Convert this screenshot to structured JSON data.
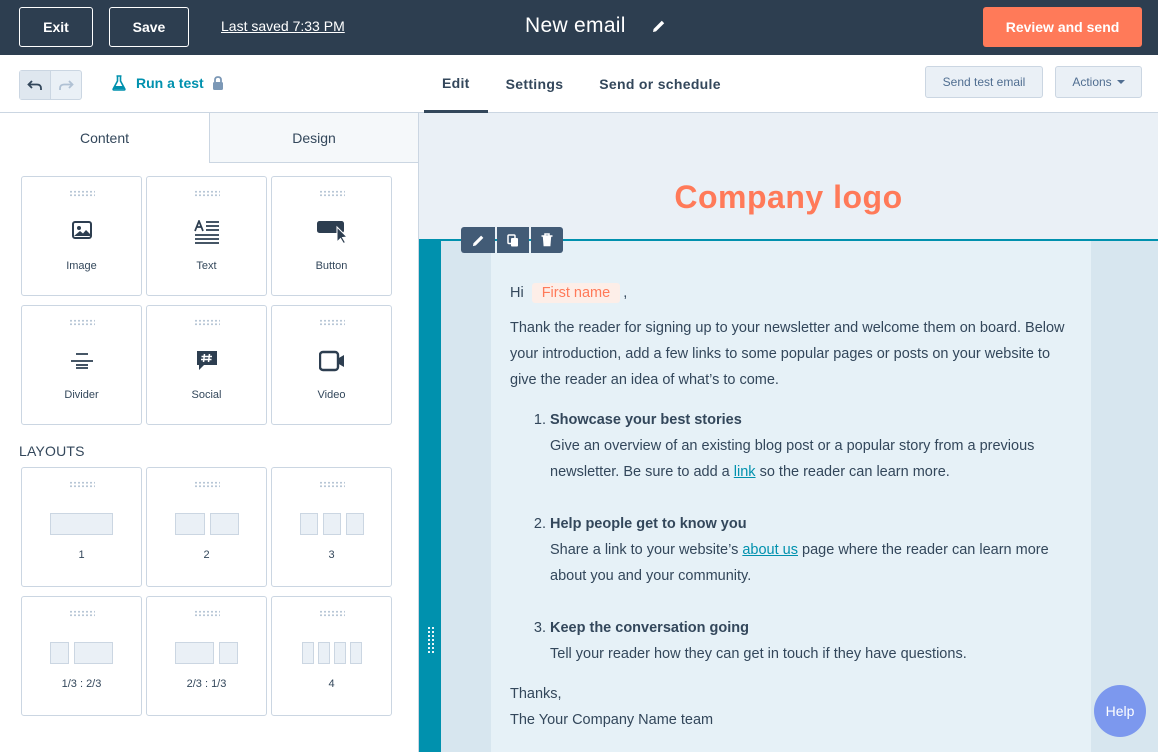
{
  "topbar": {
    "exit_label": "Exit",
    "save_label": "Save",
    "last_saved": "Last saved 7:33 PM",
    "email_title": "New email",
    "review_label": "Review and send",
    "accent_color": "#ff7a59",
    "bg_color": "#2d3e50"
  },
  "toolbar": {
    "run_test_label": "Run a test",
    "tabs": [
      {
        "label": "Edit",
        "active": true
      },
      {
        "label": "Settings",
        "active": false
      },
      {
        "label": "Send or schedule",
        "active": false
      }
    ],
    "send_test_label": "Send test email",
    "actions_label": "Actions"
  },
  "panel": {
    "tabs": {
      "content": "Content",
      "design": "Design"
    },
    "modules": [
      {
        "label": "Image",
        "icon": "image-icon"
      },
      {
        "label": "Text",
        "icon": "text-icon"
      },
      {
        "label": "Button",
        "icon": "button-icon"
      },
      {
        "label": "Divider",
        "icon": "divider-icon"
      },
      {
        "label": "Social",
        "icon": "social-icon"
      },
      {
        "label": "Video",
        "icon": "video-icon"
      }
    ],
    "layouts_heading": "LAYOUTS",
    "layouts": [
      {
        "label": "1"
      },
      {
        "label": "2"
      },
      {
        "label": "3"
      },
      {
        "label": "1/3 : 2/3"
      },
      {
        "label": "2/3 : 1/3"
      },
      {
        "label": "4"
      }
    ]
  },
  "email": {
    "logo_text": "Company logo",
    "greeting_prefix": "Hi",
    "first_name_token": "First name",
    "greeting_suffix": ",",
    "intro": "Thank the reader for signing up to your newsletter and welcome them on board. Below your introduction, add a few links to some popular pages or posts on your website to give the reader an idea of what’s to come.",
    "items": [
      {
        "title": "Showcase your best stories",
        "text_before": "Give an overview of an existing blog post or a popular story from a previous newsletter. Be sure to add a ",
        "link": "link",
        "text_after": " so the reader can learn more."
      },
      {
        "title": "Help people get to know you",
        "text_before": "Share a link to your website’s ",
        "link": "about us",
        "text_after": " page where the reader can learn more about you and your community."
      },
      {
        "title": "Keep the conversation going",
        "text_before": "Tell your reader how they can get in touch if they have questions.",
        "link": "",
        "text_after": ""
      }
    ],
    "signoff_1": "Thanks,",
    "signoff_2": "The Your Company Name team"
  },
  "help_label": "Help"
}
